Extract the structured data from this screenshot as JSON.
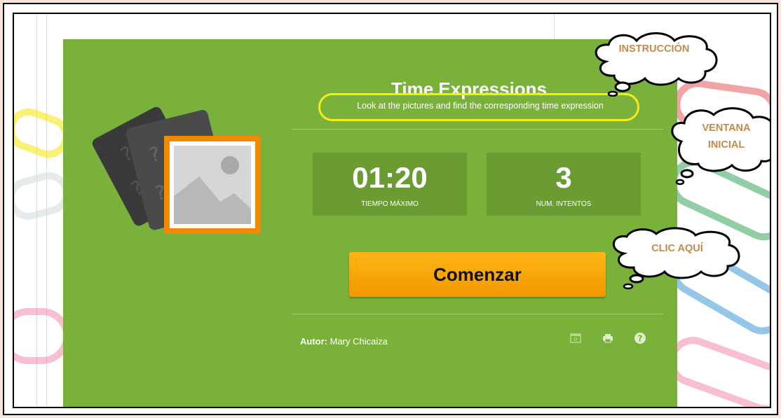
{
  "activity": {
    "title": "Time Expressions",
    "instruction": "Look at the pictures and find the corresponding time expression"
  },
  "stats": {
    "time": {
      "value": "01:20",
      "label": "TIEMPO MÁXIMO"
    },
    "attempts": {
      "value": "3",
      "label": "NUM. INTENTOS"
    }
  },
  "start_button": {
    "label": "Comenzar"
  },
  "footer": {
    "author_label": "Autor:",
    "author_name": "Mary Chicaiza",
    "icons": [
      "fullscreen-icon",
      "print-icon",
      "help-icon"
    ]
  },
  "callouts": {
    "instruction": "INSTRUCCIÓN",
    "window_line1": "VENTANA",
    "window_line2": "INICIAL",
    "click": "CLIC AQUÍ"
  },
  "colors": {
    "panel": "#79b13a",
    "stat_box": "#6a9c33",
    "button": "#f7a30a",
    "highlight": "#f4ee15",
    "callout_text": "#c48a4a"
  }
}
